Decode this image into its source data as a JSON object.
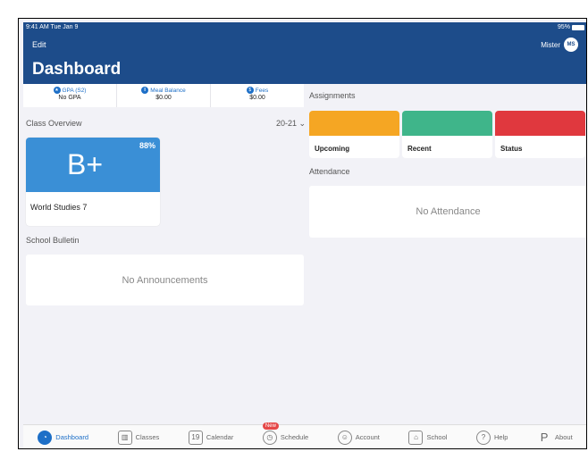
{
  "status_bar": {
    "time": "9:41 AM  Tue Jan 9",
    "battery": "95%"
  },
  "header": {
    "edit": "Edit",
    "user_name": "Mister",
    "avatar_initials": "MS",
    "title": "Dashboard"
  },
  "stats": [
    {
      "label": "GPA (S2)",
      "value": "No GPA"
    },
    {
      "label": "Meal Balance",
      "value": "$0.00"
    },
    {
      "label": "Fees",
      "value": "$0.00"
    }
  ],
  "class_overview": {
    "title": "Class Overview",
    "term": "20-21",
    "class": {
      "grade": "B+",
      "percent": "88%",
      "name": "World Studies 7"
    }
  },
  "bulletin": {
    "title": "School Bulletin",
    "empty": "No Announcements"
  },
  "assignments": {
    "title": "Assignments",
    "cards": [
      {
        "label": "Upcoming",
        "color": "#f5a623"
      },
      {
        "label": "Recent",
        "color": "#3fb58a"
      },
      {
        "label": "Status",
        "color": "#e0383e"
      }
    ]
  },
  "attendance": {
    "title": "Attendance",
    "empty": "No Attendance"
  },
  "tabs": [
    {
      "label": "Dashboard",
      "icon": "dashboard-icon"
    },
    {
      "label": "Classes",
      "icon": "classes-icon"
    },
    {
      "label": "Calendar",
      "icon": "calendar-icon",
      "icon_text": "19"
    },
    {
      "label": "Schedule",
      "icon": "schedule-icon",
      "badge": "New"
    },
    {
      "label": "Account",
      "icon": "account-icon"
    },
    {
      "label": "School",
      "icon": "school-icon"
    },
    {
      "label": "Help",
      "icon": "help-icon",
      "icon_text": "?"
    },
    {
      "label": "About",
      "icon": "about-icon",
      "icon_text": "P"
    }
  ]
}
